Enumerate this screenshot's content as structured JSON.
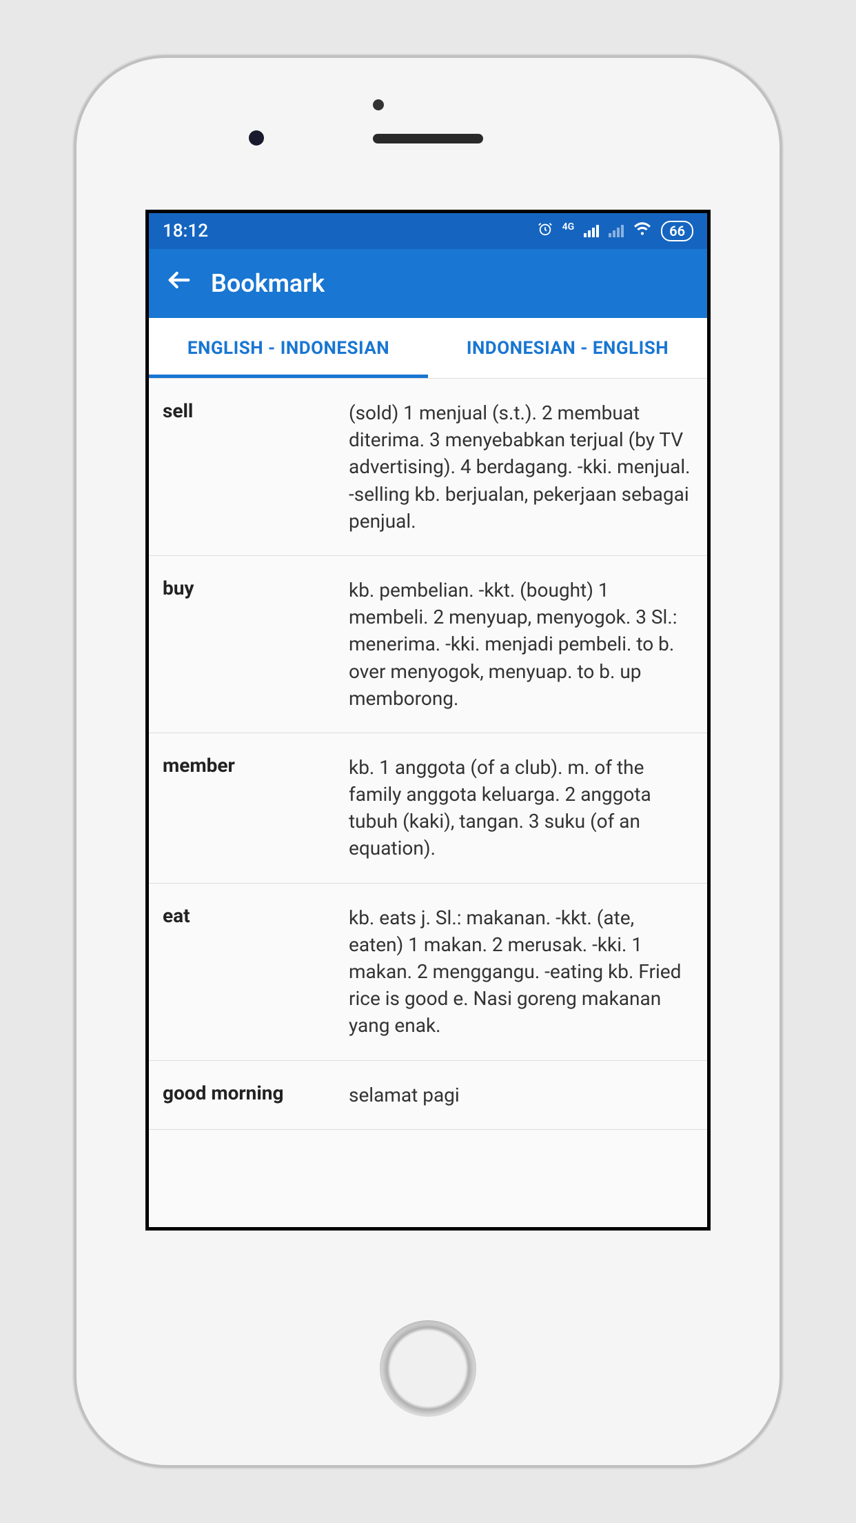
{
  "status": {
    "time": "18:12",
    "network": "4G",
    "battery": "66"
  },
  "header": {
    "title": "Bookmark"
  },
  "tabs": [
    {
      "label": "ENGLISH - INDONESIAN",
      "active": true
    },
    {
      "label": "INDONESIAN - ENGLISH",
      "active": false
    }
  ],
  "entries": [
    {
      "word": "sell",
      "definition": "(sold) 1 menjual (s.t.). 2 membuat diterima. 3 menyebabkan terjual (by TV advertising). 4 berdagang. -kki. menjual. -selling kb. berjualan, pekerjaan sebagai penjual."
    },
    {
      "word": "buy",
      "definition": "kb. pembelian. -kkt. (bought) 1 membeli. 2 menyuap, menyogok. 3 Sl.: menerima. -kki. menjadi pembeli. to b. over menyogok, menyuap. to b. up memborong."
    },
    {
      "word": "member",
      "definition": "kb. 1 anggota (of a club). m. of the family anggota keluarga. 2 anggota tubuh (kaki), tangan. 3 suku (of an equation)."
    },
    {
      "word": "eat",
      "definition": "kb. eats j. Sl.: makanan. -kkt. (ate, eaten) 1 makan. 2 merusak. -kki. 1 makan. 2 menggangu.  -eating kb. Fried rice is good e. Nasi goreng makanan  yang enak."
    },
    {
      "word": "good morning",
      "definition": "selamat pagi"
    }
  ]
}
